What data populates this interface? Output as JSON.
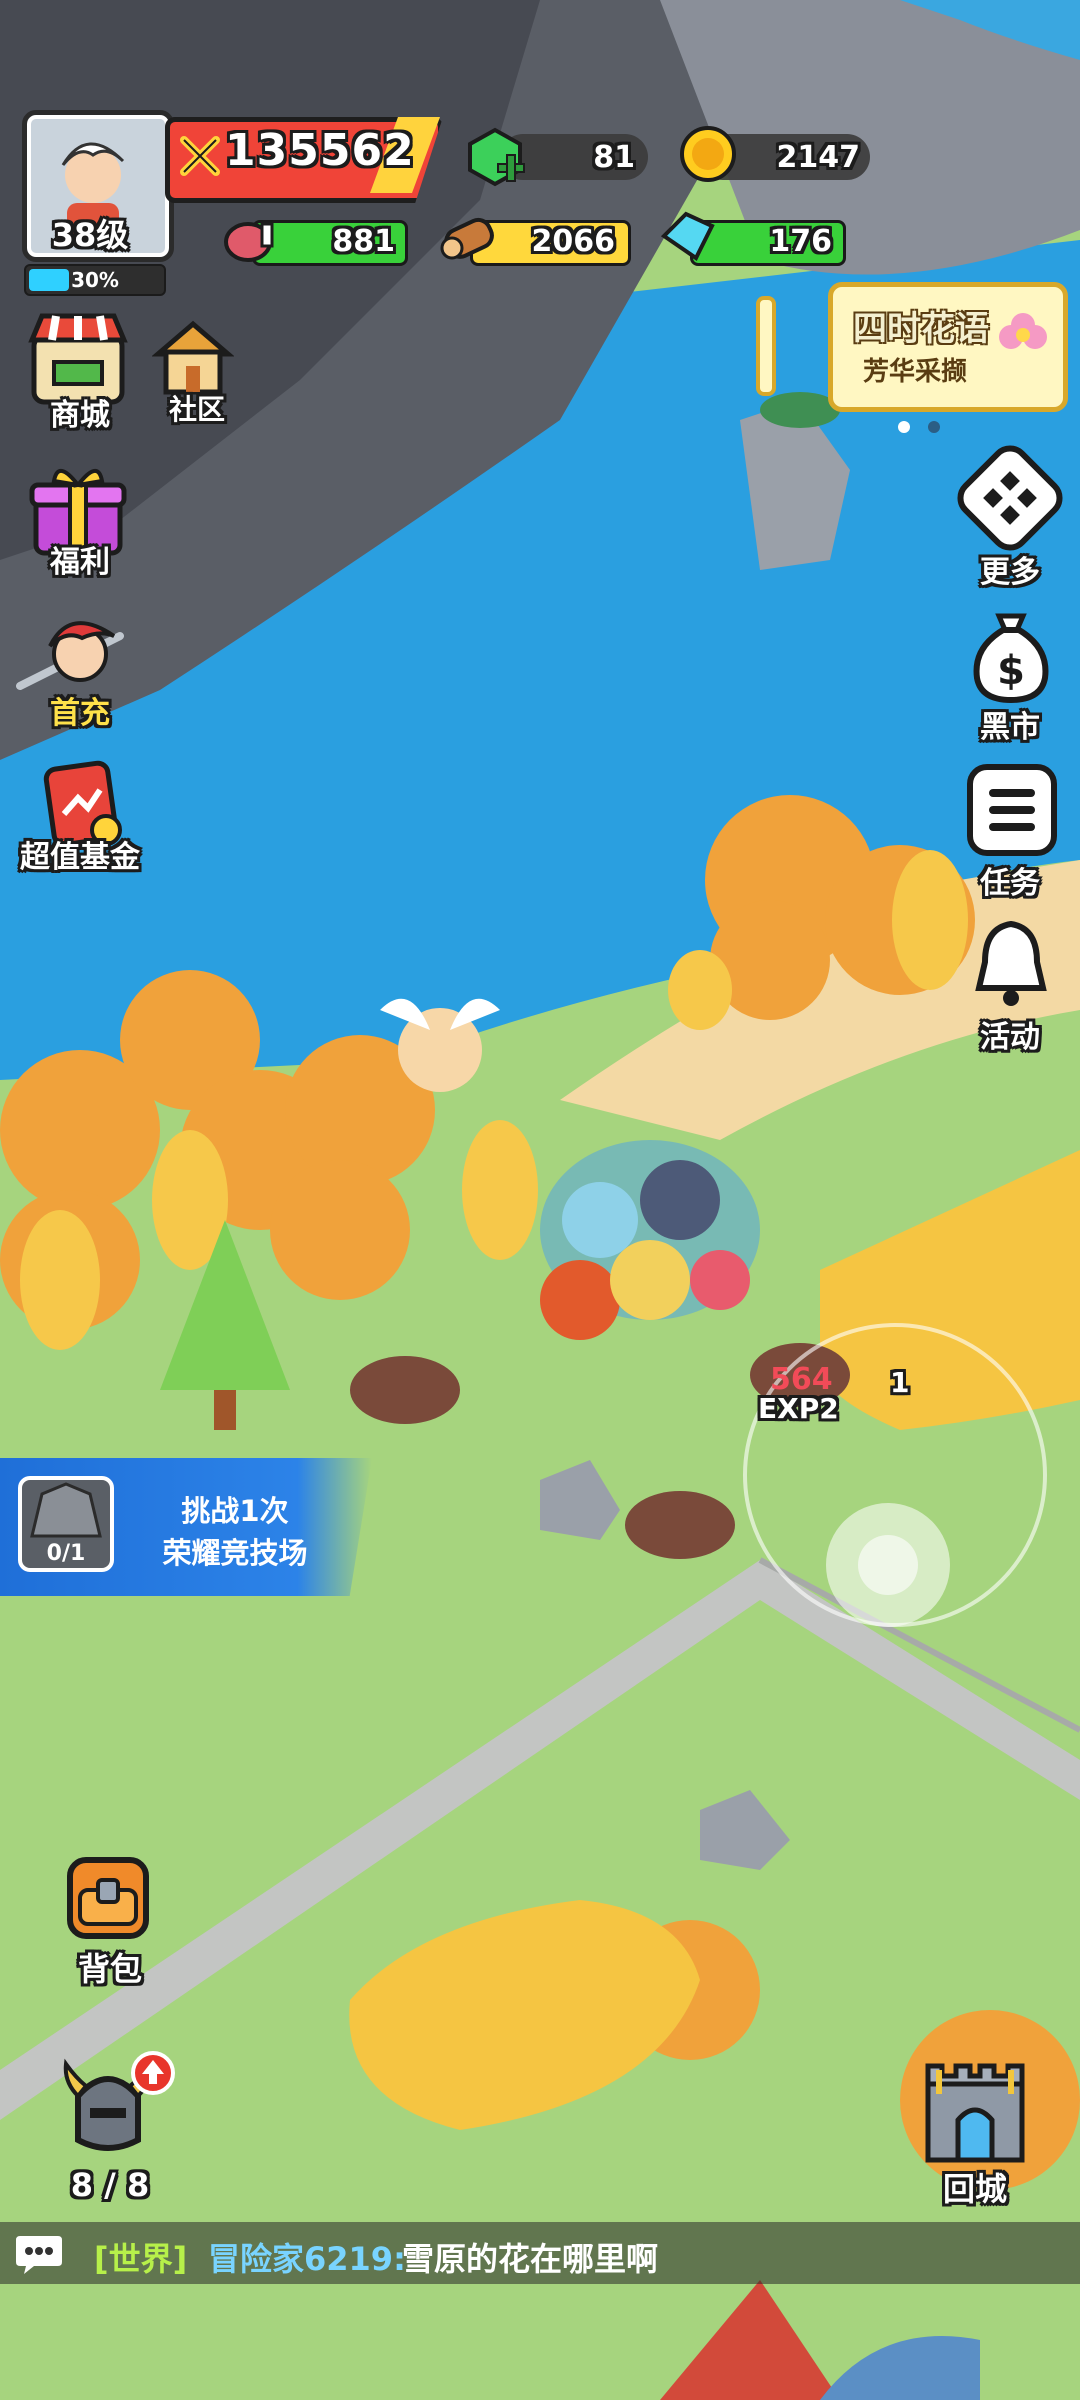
{
  "player": {
    "level": "38级",
    "xp_percent": 30,
    "xp_label": "30%",
    "power": "135562"
  },
  "currency": {
    "gems": "81",
    "gold": "2147",
    "meat": "881",
    "wood": "2066",
    "crystal": "176"
  },
  "left_menu": {
    "shop": "商城",
    "community": "社区",
    "welfare": "福利",
    "first_charge": "首充",
    "fund": "超值基金"
  },
  "right_menu": {
    "more": "更多",
    "black_market": "黑市",
    "tasks": "任务",
    "events": "活动"
  },
  "event_banner": {
    "title": "四时花语",
    "subtitle": "芳华采撷"
  },
  "quest": {
    "progress": "0/1",
    "line1": "挑战1次",
    "line2": "荣耀竞技场"
  },
  "combat": {
    "damage": "564",
    "exp": "EXP2",
    "count": "1"
  },
  "bottom": {
    "backpack": "背包",
    "heroes": "8 / 8",
    "return_city": "回城"
  },
  "chat": {
    "channel": "[世界]",
    "sender": "冒险家6219:",
    "message": "雪原的花在哪里啊"
  },
  "colors": {
    "meat_bar": "#39d13a",
    "wood_bar": "#ffd83c",
    "crystal_bar": "#39d13a",
    "xp": "#2fd0ff",
    "power": "#f04438"
  }
}
